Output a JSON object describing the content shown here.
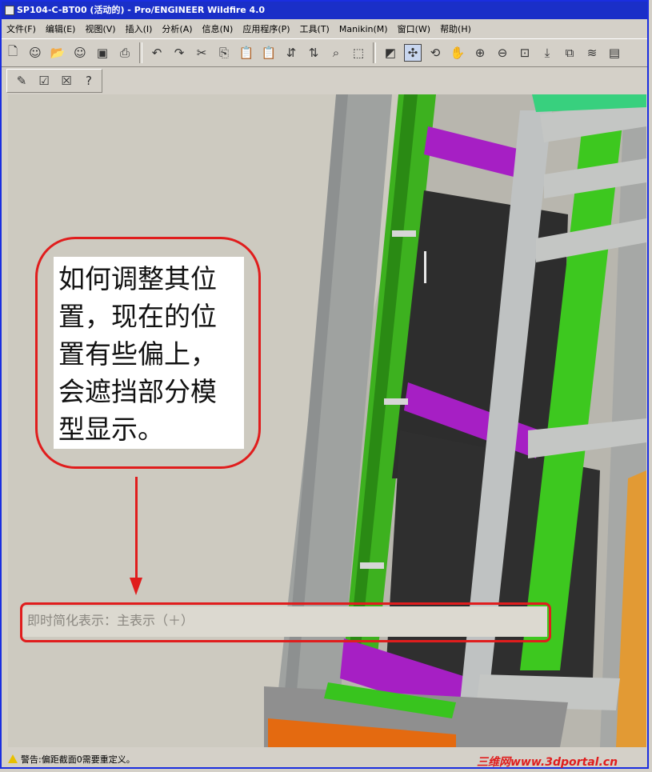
{
  "window": {
    "title": "SP104-C-BT00 (活动的) - Pro/ENGINEER Wildfire 4.0"
  },
  "menu": [
    "文件(F)",
    "编辑(E)",
    "视图(V)",
    "插入(I)",
    "分析(A)",
    "信息(N)",
    "应用程序(P)",
    "工具(T)",
    "Manikin(M)",
    "窗口(W)",
    "帮助(H)"
  ],
  "toolbar_icons": [
    "new-file-icon",
    "smiley-icon",
    "open-folder-icon",
    "smiley-icon",
    "save-icon",
    "print-icon",
    "undo-icon",
    "redo-icon",
    "cut-icon",
    "copy-icon",
    "paste-icon",
    "paste-special-icon",
    "regenerate-icon",
    "regenerate-manager-icon",
    "find-icon",
    "select-box-icon",
    "repaint-icon",
    "spin-center-icon",
    "orient-icon",
    "pan-icon",
    "zoom-in-icon",
    "zoom-out-icon",
    "refit-icon",
    "reorient-icon",
    "saved-views-icon",
    "layers-icon",
    "view-manager-icon"
  ],
  "toolbar2_icons": [
    "edit-pencil-icon",
    "accept-icon",
    "cancel-icon",
    "whats-this-icon"
  ],
  "annotation": {
    "text": "如何调整其位置，现在的位置有些偏上，会遮挡部分模型显示。"
  },
  "representation": {
    "label": "即时简化表示：主表示（＋）"
  },
  "status": {
    "message": "警告:偏距截面0需要重定义。"
  },
  "watermark": {
    "text": "三维网www.3dportal.cn"
  }
}
